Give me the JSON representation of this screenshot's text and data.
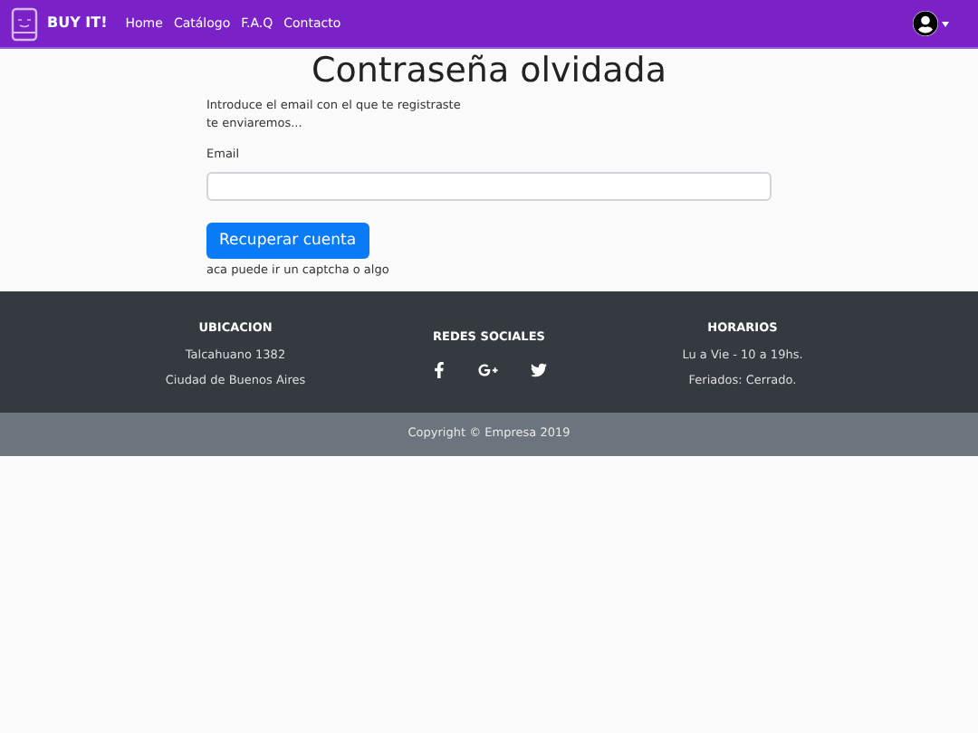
{
  "navbar": {
    "brand": "BUY IT!",
    "links": [
      {
        "label": "Home"
      },
      {
        "label": "Catálogo"
      },
      {
        "label": "F.A.Q"
      },
      {
        "label": "Contacto"
      }
    ]
  },
  "page": {
    "title": "Contraseña olvidada",
    "intro": [
      "Introduce el email con el que te registraste",
      "te enviaremos..."
    ],
    "email_label": "Email",
    "button": "Recuperar cuenta",
    "note": "aca puede ir un captcha o algo"
  },
  "footer": {
    "columns": [
      {
        "kind": "text",
        "title": "UBICACION",
        "lines": [
          "Talcahuano 1382",
          "Ciudad de Buenos Aires"
        ]
      },
      {
        "kind": "social",
        "title": "REDES SOCIALES"
      },
      {
        "kind": "text",
        "title": "HORARIOS",
        "lines": [
          "Lu a Vie - 10 a 19hs.",
          "Feriados: Cerrado."
        ]
      }
    ],
    "copyright": "Copyright © Empresa 2019"
  }
}
